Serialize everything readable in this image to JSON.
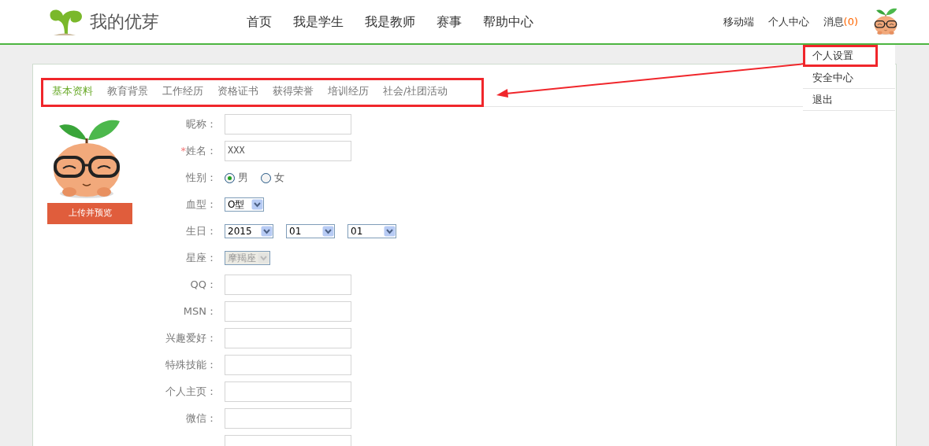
{
  "header": {
    "logo_text": "我的优芽",
    "nav": [
      {
        "label": "首页"
      },
      {
        "label": "我是学生"
      },
      {
        "label": "我是教师"
      },
      {
        "label": "赛事"
      },
      {
        "label": "帮助中心"
      }
    ],
    "right_links": [
      {
        "label": "移动端"
      },
      {
        "label": "个人中心"
      }
    ],
    "messages": {
      "label": "消息",
      "count": "(0)"
    }
  },
  "user_menu": {
    "items": [
      {
        "label": "个人设置",
        "highlighted": true
      },
      {
        "label": "安全中心",
        "highlighted": false
      },
      {
        "label": "退出",
        "highlighted": false
      }
    ]
  },
  "tabs_highlighted": true,
  "tabs": [
    {
      "label": "基本资料",
      "selected": true
    },
    {
      "label": "教育背景",
      "selected": false
    },
    {
      "label": "工作经历",
      "selected": false
    },
    {
      "label": "资格证书",
      "selected": false
    },
    {
      "label": "获得荣誉",
      "selected": false
    },
    {
      "label": "培训经历",
      "selected": false
    },
    {
      "label": "社会/社团活动",
      "selected": false
    }
  ],
  "upload_button": "上传并预览",
  "form": [
    {
      "kind": "text",
      "label": "昵称："
    },
    {
      "kind": "text",
      "label": "姓名：",
      "required_mark": "*",
      "value": "XXX"
    },
    {
      "kind": "radio",
      "label": "性别：",
      "options": [
        {
          "label": "男",
          "selected": true
        },
        {
          "label": "女",
          "selected": false
        }
      ]
    },
    {
      "kind": "select",
      "label": "血型：",
      "selects": [
        {
          "value": "O型",
          "disabled": false
        }
      ]
    },
    {
      "kind": "select",
      "label": "生日：",
      "selects": [
        {
          "value": "2015",
          "disabled": false
        },
        {
          "value": "01",
          "disabled": false
        },
        {
          "value": "01",
          "disabled": false
        }
      ]
    },
    {
      "kind": "select",
      "label": "星座：",
      "selects": [
        {
          "value": "摩羯座",
          "disabled": true
        }
      ]
    },
    {
      "kind": "text",
      "label": "QQ："
    },
    {
      "kind": "text",
      "label": "MSN："
    },
    {
      "kind": "text",
      "label": "兴趣爱好："
    },
    {
      "kind": "text",
      "label": "特殊技能："
    },
    {
      "kind": "text",
      "label": "个人主页："
    },
    {
      "kind": "text",
      "label": "微信："
    },
    {
      "kind": "text"
    }
  ]
}
